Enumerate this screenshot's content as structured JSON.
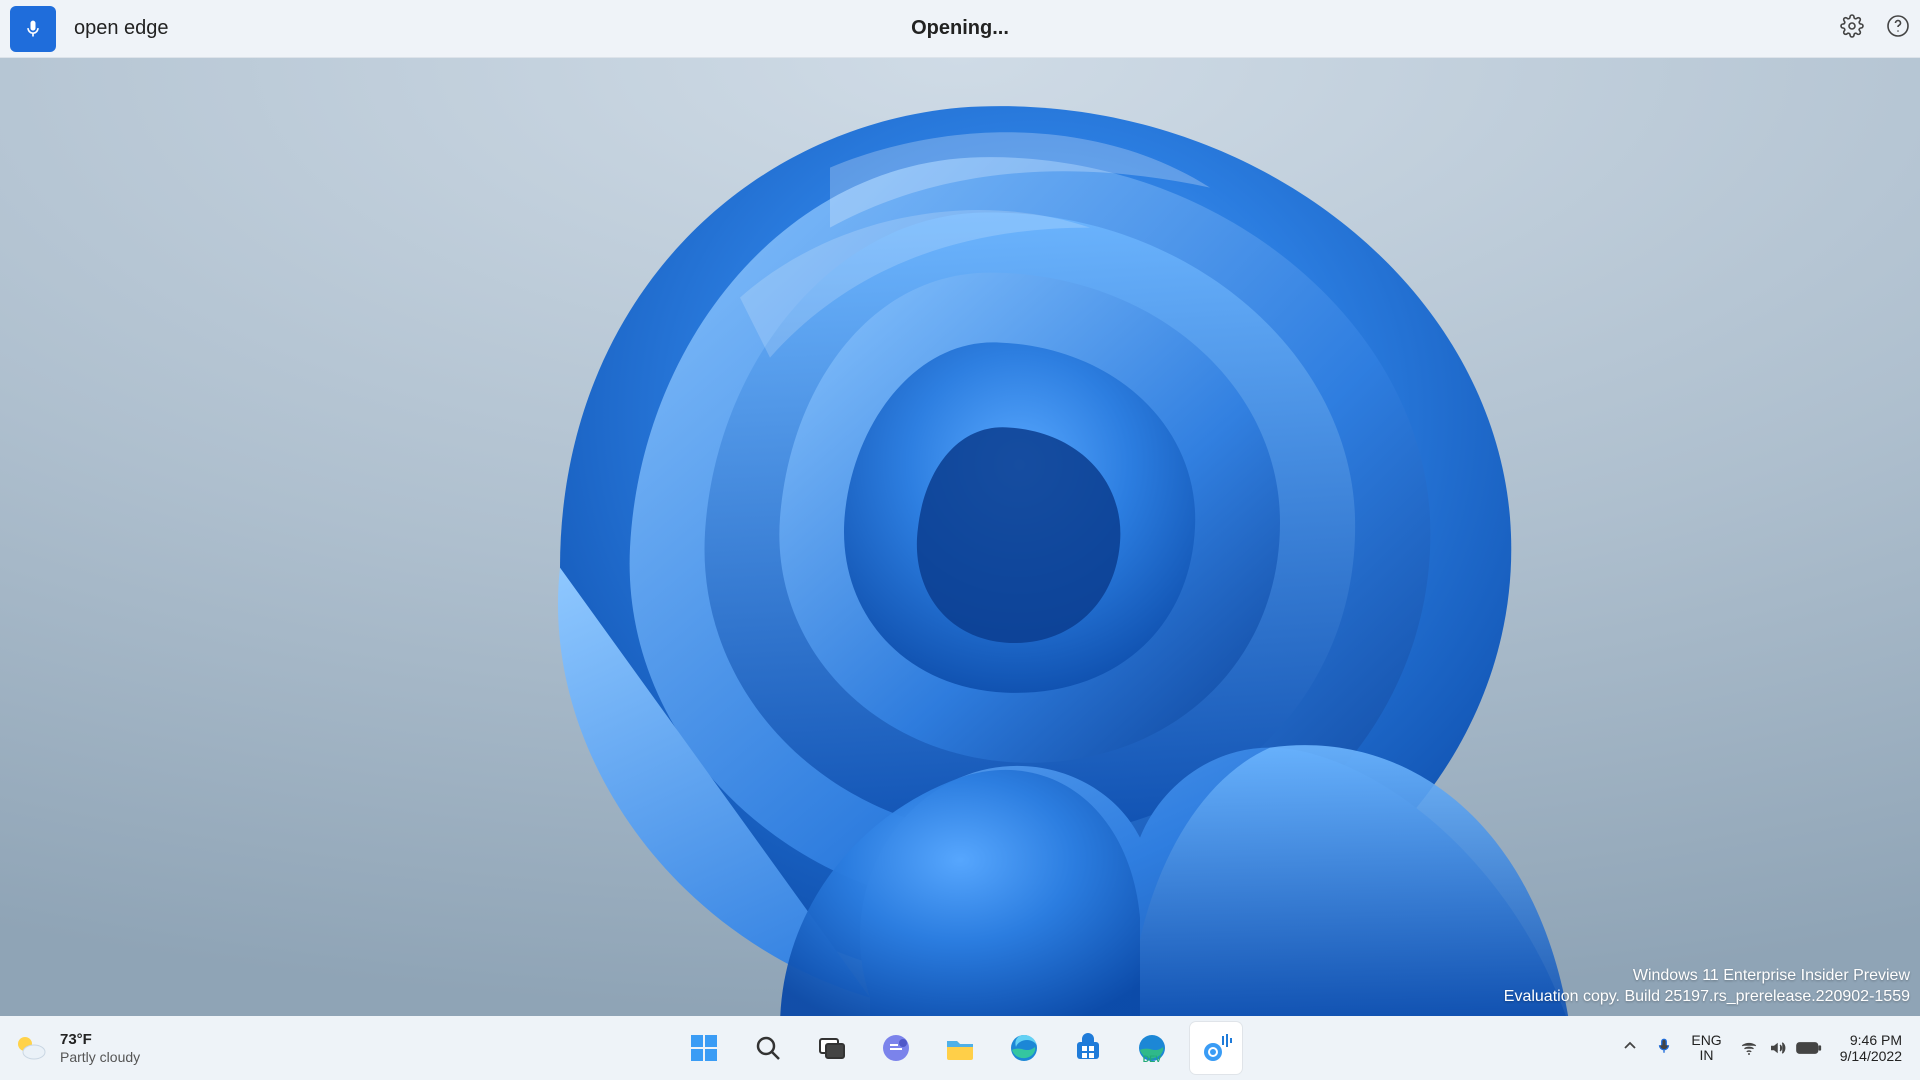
{
  "voice": {
    "command": "open edge",
    "status": "Opening..."
  },
  "watermark": {
    "line1": "Windows 11 Enterprise Insider Preview",
    "line2": "Evaluation copy. Build 25197.rs_prerelease.220902-1559"
  },
  "weather": {
    "temp": "73°F",
    "condition": "Partly cloudy"
  },
  "language": {
    "top": "ENG",
    "bottom": "IN"
  },
  "clock": {
    "time": "9:46 PM",
    "date": "9/14/2022"
  },
  "taskbar_items": [
    {
      "name": "start",
      "label": "Start"
    },
    {
      "name": "search",
      "label": "Search"
    },
    {
      "name": "task-view",
      "label": "Task View"
    },
    {
      "name": "chat",
      "label": "Chat"
    },
    {
      "name": "file-explorer",
      "label": "File Explorer"
    },
    {
      "name": "edge",
      "label": "Microsoft Edge"
    },
    {
      "name": "store",
      "label": "Microsoft Store"
    },
    {
      "name": "edge-dev",
      "label": "Edge Dev"
    },
    {
      "name": "voice-access",
      "label": "Voice Access",
      "active": true
    }
  ]
}
